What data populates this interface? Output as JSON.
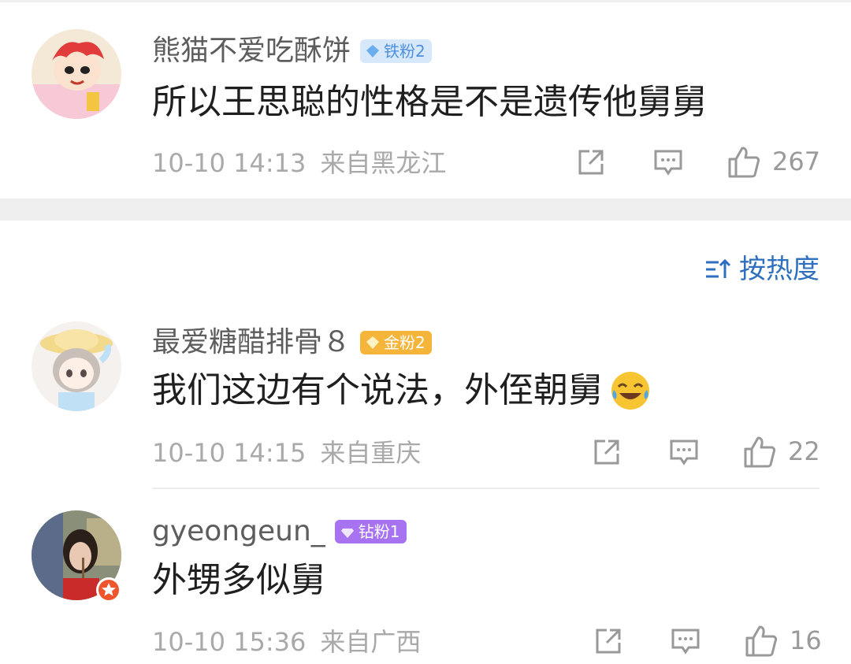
{
  "comments": [
    {
      "username": "熊猫不爱吃酥饼",
      "badge": "铁粉2",
      "text": "所以王思聪的性格是不是遗传他舅舅",
      "time": "10-10 14:13",
      "location": "来自黑龙江",
      "likes": "267"
    },
    {
      "username": "最爱糖醋排骨８",
      "badge": "金粉2",
      "text": "我们这边有个说法，外侄朝舅",
      "emoji": "laugh-cry-emoji",
      "time": "10-10 14:15",
      "location": "来自重庆",
      "likes": "22"
    },
    {
      "username": "gyeongeun_",
      "badge": "钻粉1",
      "text": "外甥多似舅",
      "time": "10-10 15:36",
      "location": "来自广西",
      "likes": "16"
    }
  ],
  "sort": {
    "label": "按热度"
  },
  "colors": {
    "link": "#2f6fbf",
    "iron_badge": "#d7e8fb",
    "gold_badge": "#f5b53b",
    "diamond_badge": "#a873f0"
  }
}
